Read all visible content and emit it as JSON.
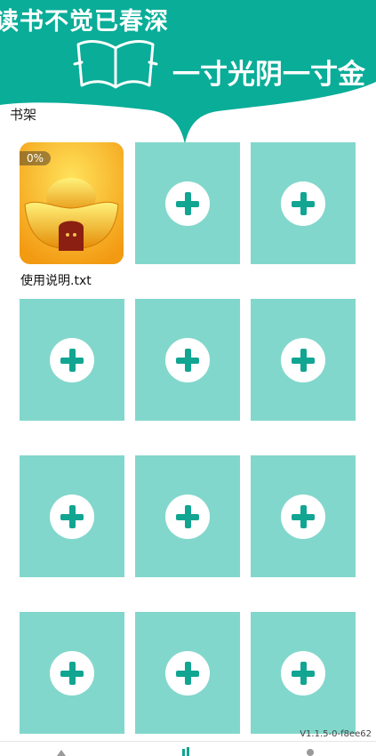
{
  "header": {
    "slogan_top": "读书不觉已春深",
    "slogan_right": "一寸光阴一寸金",
    "colors": {
      "banner": "#09ad98",
      "cell": "#82d7cc",
      "plus": "#11a592"
    }
  },
  "shelf": {
    "title": "书架",
    "books": [
      {
        "name": "使用说明.txt",
        "progress": "0%",
        "cover_icon": "gold-ingot-icon"
      }
    ],
    "empty_slot_icon": "add-icon"
  },
  "footer": {
    "version": "V1.1.5-0-f8ee62",
    "nav_tabs": [
      "home-icon",
      "bookshelf-icon",
      "profile-icon"
    ]
  }
}
